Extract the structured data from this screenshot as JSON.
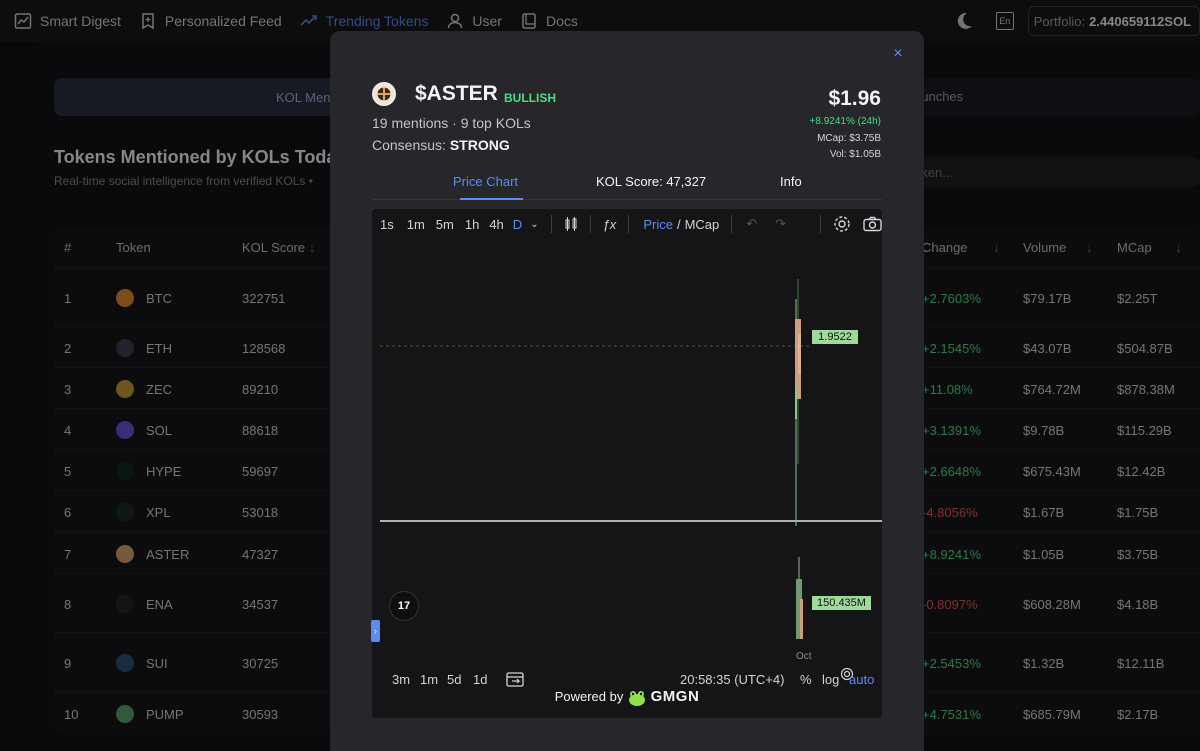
{
  "nav": {
    "items": [
      {
        "label": "Smart Digest",
        "icon": "chart-icon",
        "active": false
      },
      {
        "label": "Personalized Feed",
        "icon": "bookmark-icon",
        "active": false
      },
      {
        "label": "Trending Tokens",
        "icon": "trend-icon",
        "active": true
      },
      {
        "label": "User",
        "icon": "user-icon",
        "active": false
      },
      {
        "label": "Docs",
        "icon": "book-icon",
        "active": false
      }
    ],
    "lang": "En",
    "portfolio_label": "Portfolio:",
    "portfolio_value": "2.440659112SOL"
  },
  "page": {
    "tab_left": "KOL Ment",
    "tab_right": "aunches",
    "title": "Tokens Mentioned by KOLs Today",
    "subtitle": "Real-time social intelligence from verified KOLs •",
    "search_placeholder": "oken...",
    "columns": {
      "num": "#",
      "token": "Token",
      "kol_score": "KOL Score",
      "change": "Change",
      "volume": "Volume",
      "mcap": "MCap"
    },
    "rows": [
      {
        "num": "1",
        "token": "BTC",
        "score": "322751",
        "change": "+2.7603%",
        "dir": "up",
        "volume": "$79.17B",
        "mcap": "$2.25T",
        "color": "#e38b2c"
      },
      {
        "num": "2",
        "token": "ETH",
        "score": "128568",
        "change": "+2.1545%",
        "dir": "up",
        "volume": "$43.07B",
        "mcap": "$504.87B",
        "color": "#3f3f55"
      },
      {
        "num": "3",
        "token": "ZEC",
        "score": "89210",
        "change": "+11.08%",
        "dir": "up",
        "volume": "$764.72M",
        "mcap": "$878.38M",
        "color": "#c99a35"
      },
      {
        "num": "4",
        "token": "SOL",
        "score": "88618",
        "change": "+3.1391%",
        "dir": "up",
        "volume": "$9.78B",
        "mcap": "$115.29B",
        "color": "#6d4fd8"
      },
      {
        "num": "5",
        "token": "HYPE",
        "score": "59697",
        "change": "+2.6648%",
        "dir": "up",
        "volume": "$675.43M",
        "mcap": "$12.42B",
        "color": "#0b2a25"
      },
      {
        "num": "6",
        "token": "XPL",
        "score": "53018",
        "change": "-4.8056%",
        "dir": "down",
        "volume": "$1.67B",
        "mcap": "$1.75B",
        "color": "#1d2a25"
      },
      {
        "num": "7",
        "token": "ASTER",
        "score": "47327",
        "change": "+8.9241%",
        "dir": "up",
        "volume": "$1.05B",
        "mcap": "$3.75B",
        "color": "#d7a46a"
      },
      {
        "num": "8",
        "token": "ENA",
        "score": "34537",
        "change": "-0.8097%",
        "dir": "down",
        "volume": "$608.28M",
        "mcap": "$4.18B",
        "color": "#25252a"
      },
      {
        "num": "9",
        "token": "SUI",
        "score": "30725",
        "change": "+2.5453%",
        "dir": "up",
        "volume": "$1.32B",
        "mcap": "$12.11B",
        "color": "#2f4f7a"
      },
      {
        "num": "10",
        "token": "PUMP",
        "score": "30593",
        "change": "+4.7531%",
        "dir": "up",
        "volume": "$685.79M",
        "mcap": "$2.17B",
        "color": "#5aa36b"
      }
    ]
  },
  "modal": {
    "close": "×",
    "token_name": "$ASTER",
    "badge": "BULLISH",
    "mentions": "19 mentions · 9 top KOLs",
    "consensus_label": "Consensus:",
    "consensus_value": "STRONG",
    "price": "$1.96",
    "change": "+8.9241% (24h)",
    "mcap": "MCap: $3.75B",
    "vol": "Vol: $1.05B",
    "tabs": [
      "Price Chart",
      "KOL Score: 47,327",
      "Info"
    ],
    "chart": {
      "intervals": [
        "1s",
        "1m",
        "5m",
        "1h",
        "4h",
        "D"
      ],
      "price_label": "Price",
      "mcap_label": "MCap",
      "price_marker": "1.9522",
      "volume_marker": "150.435M",
      "ranges": [
        "3m",
        "1m",
        "5d",
        "1d"
      ],
      "time": "20:58:35 (UTC+4)",
      "scale_opts": [
        "%",
        "log",
        "auto"
      ],
      "x_tick": "Oct",
      "powered_by": "Powered by",
      "brand": "GMGN",
      "tv": "17"
    }
  },
  "colors": {
    "accent": "#5b8def",
    "up": "#4ade80",
    "down": "#f05252"
  }
}
